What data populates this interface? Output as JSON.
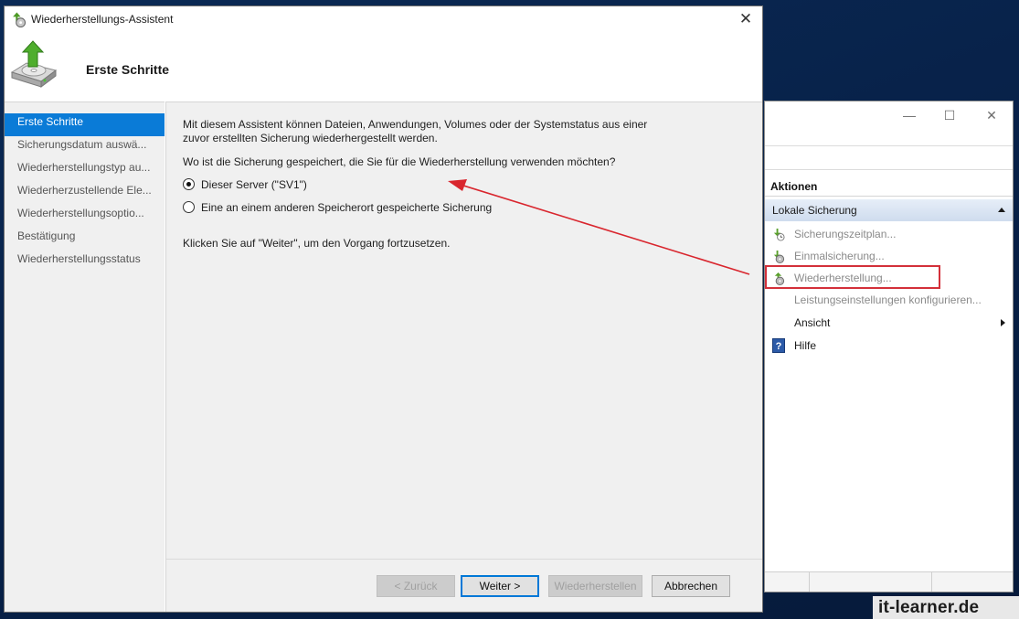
{
  "wizard": {
    "title": "Wiederherstellungs-Assistent",
    "header_title": "Erste Schritte",
    "close_glyph": "✕",
    "nav_items": [
      "Erste Schritte",
      "Sicherungsdatum auswä...",
      "Wiederherstellungstyp au...",
      "Wiederherzustellende Ele...",
      "Wiederherstellungsoptio...",
      "Bestätigung",
      "Wiederherstellungsstatus"
    ],
    "active_nav_index": 0,
    "intro_line1": "Mit diesem Assistent können Dateien, Anwendungen, Volumes oder der Systemstatus aus einer",
    "intro_line2": "zuvor erstellten Sicherung wiederhergestellt werden.",
    "question": "Wo ist die Sicherung gespeichert, die Sie für die Wiederherstellung verwenden möchten?",
    "options": [
      {
        "label": "Dieser Server (\"SV1\")",
        "selected": true
      },
      {
        "label": "Eine an einem anderen Speicherort gespeicherte Sicherung",
        "selected": false
      }
    ],
    "continue_text": "Klicken Sie auf \"Weiter\", um den Vorgang fortzusetzen.",
    "buttons": {
      "back": "< Zurück",
      "next": "Weiter >",
      "restore": "Wiederherstellen",
      "cancel": "Abbrechen"
    }
  },
  "background_window": {
    "minimize_glyph": "—",
    "maximize_glyph": "☐",
    "close_glyph": "✕",
    "actions_header": "Aktionen",
    "group_label": "Lokale Sicherung",
    "actions": [
      {
        "label": "Sicherungszeitplan...",
        "icon": "backup-schedule-icon",
        "enabled": false
      },
      {
        "label": "Einmalsicherung...",
        "icon": "backup-once-icon",
        "enabled": false
      },
      {
        "label": "Wiederherstellung...",
        "icon": "recover-icon",
        "enabled": false,
        "highlighted": true
      },
      {
        "label": "Leistungseinstellungen konfigurieren...",
        "icon": "",
        "enabled": false
      },
      {
        "label": "Ansicht",
        "icon": "",
        "enabled": true,
        "submenu": true
      },
      {
        "label": "Hilfe",
        "icon": "help-icon",
        "enabled": true
      }
    ],
    "highlight_color": "#d3303a"
  },
  "annotation": {
    "arrow_color": "#d9262e"
  },
  "watermark": "it-learner.de",
  "colors": {
    "accent": "#0a7bd7",
    "desktop": "#0b2a55"
  }
}
